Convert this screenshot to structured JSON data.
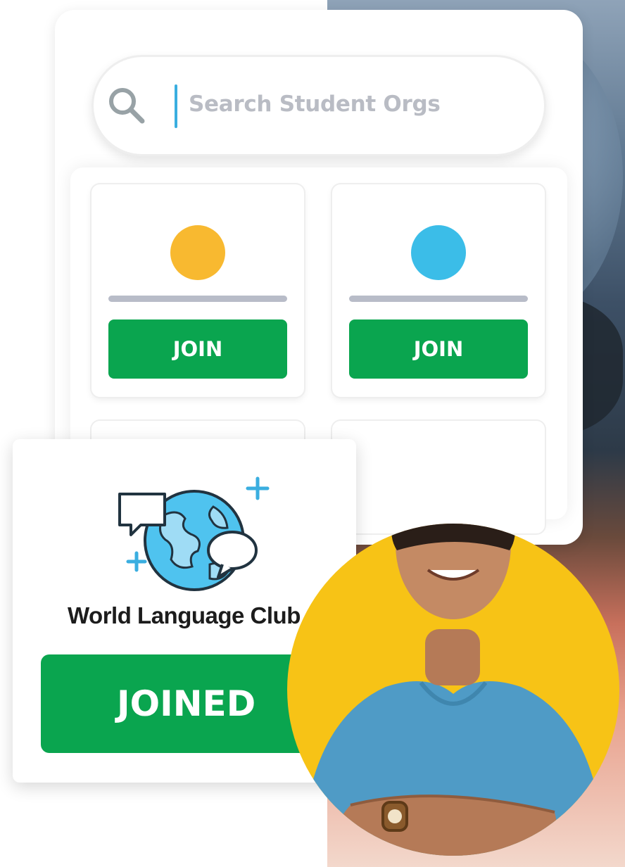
{
  "search": {
    "placeholder": "Search Student Orgs",
    "icon": "search-icon"
  },
  "org_tiles": [
    {
      "color": "#f8b930",
      "button_label": "JOIN"
    },
    {
      "color": "#3bbde8",
      "button_label": "JOIN"
    }
  ],
  "club_card": {
    "name": "World Language Club",
    "icon": "globe-with-speech-bubbles-icon",
    "button_label": "JOINED"
  },
  "colors": {
    "accent_green": "#0aa54f",
    "portrait_bg": "#f7c316",
    "caret_blue": "#3aaee0"
  }
}
